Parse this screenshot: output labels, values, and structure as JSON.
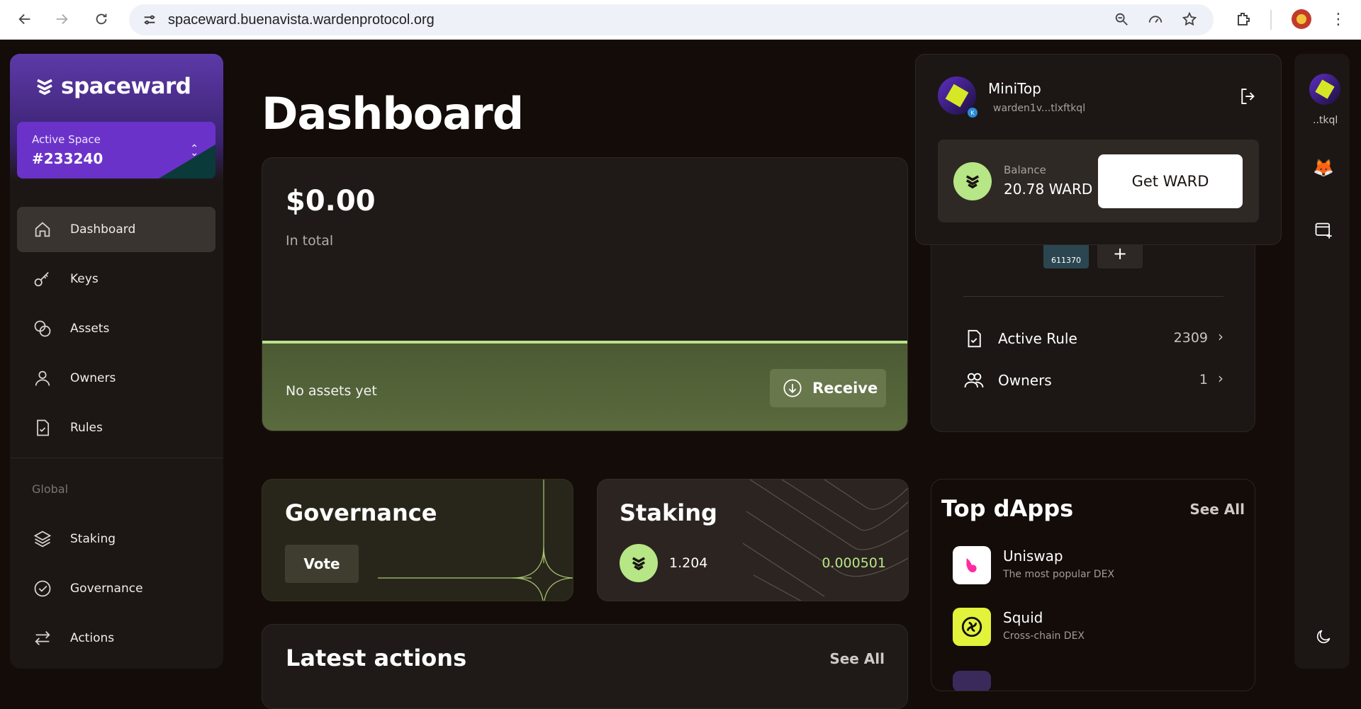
{
  "browser": {
    "url": "spaceward.buenavista.wardenprotocol.org",
    "icons": [
      "back-icon",
      "forward-icon",
      "reload-icon",
      "site-settings-icon",
      "zoom-icon",
      "performance-icon",
      "star-icon",
      "extensions-icon",
      "profile-avatar",
      "kebab-menu-icon"
    ]
  },
  "sidebar": {
    "brand": "spaceward",
    "active_space_label": "Active Space",
    "active_space_value": "#233240",
    "items": [
      {
        "label": "Dashboard",
        "icon": "home-icon"
      },
      {
        "label": "Keys",
        "icon": "key-icon"
      },
      {
        "label": "Assets",
        "icon": "coins-icon"
      },
      {
        "label": "Owners",
        "icon": "user-icon"
      },
      {
        "label": "Rules",
        "icon": "file-check-icon"
      }
    ],
    "global_label": "Global",
    "global_items": [
      {
        "label": "Staking",
        "icon": "layers-icon"
      },
      {
        "label": "Governance",
        "icon": "check-circle-icon"
      },
      {
        "label": "Actions",
        "icon": "arrows-icon"
      }
    ]
  },
  "main": {
    "title": "Dashboard",
    "total": {
      "amount": "$0.00",
      "label": "In total",
      "empty": "No assets yet",
      "receive": "Receive"
    },
    "governance": {
      "title": "Governance",
      "vote": "Vote"
    },
    "staking": {
      "title": "Staking",
      "amount": "1.204",
      "reward": "0.000501"
    },
    "latest": {
      "title": "Latest actions",
      "see_all": "See All"
    }
  },
  "space_card": {
    "key_thumb_label": "611370",
    "plus": "+",
    "active_rule_label": "Active Rule",
    "active_rule_count": "2309",
    "owners_label": "Owners",
    "owners_count": "1"
  },
  "dapps": {
    "title": "Top dApps",
    "see_all": "See All",
    "items": [
      {
        "name": "Uniswap",
        "desc": "The most popular DEX",
        "color": "#ffffff"
      },
      {
        "name": "Squid",
        "desc": "Cross-chain DEX",
        "color": "#e3f23a"
      }
    ]
  },
  "popup": {
    "name": "MiniTop",
    "address": "warden1v...tlxftkql",
    "balance_label": "Balance",
    "balance_value": "20.78 WARD",
    "get_ward": "Get WARD"
  },
  "strip": {
    "short_addr": "..tkql"
  },
  "colors": {
    "accent_green": "#b6e685",
    "space_purple": "#6b32c9"
  }
}
